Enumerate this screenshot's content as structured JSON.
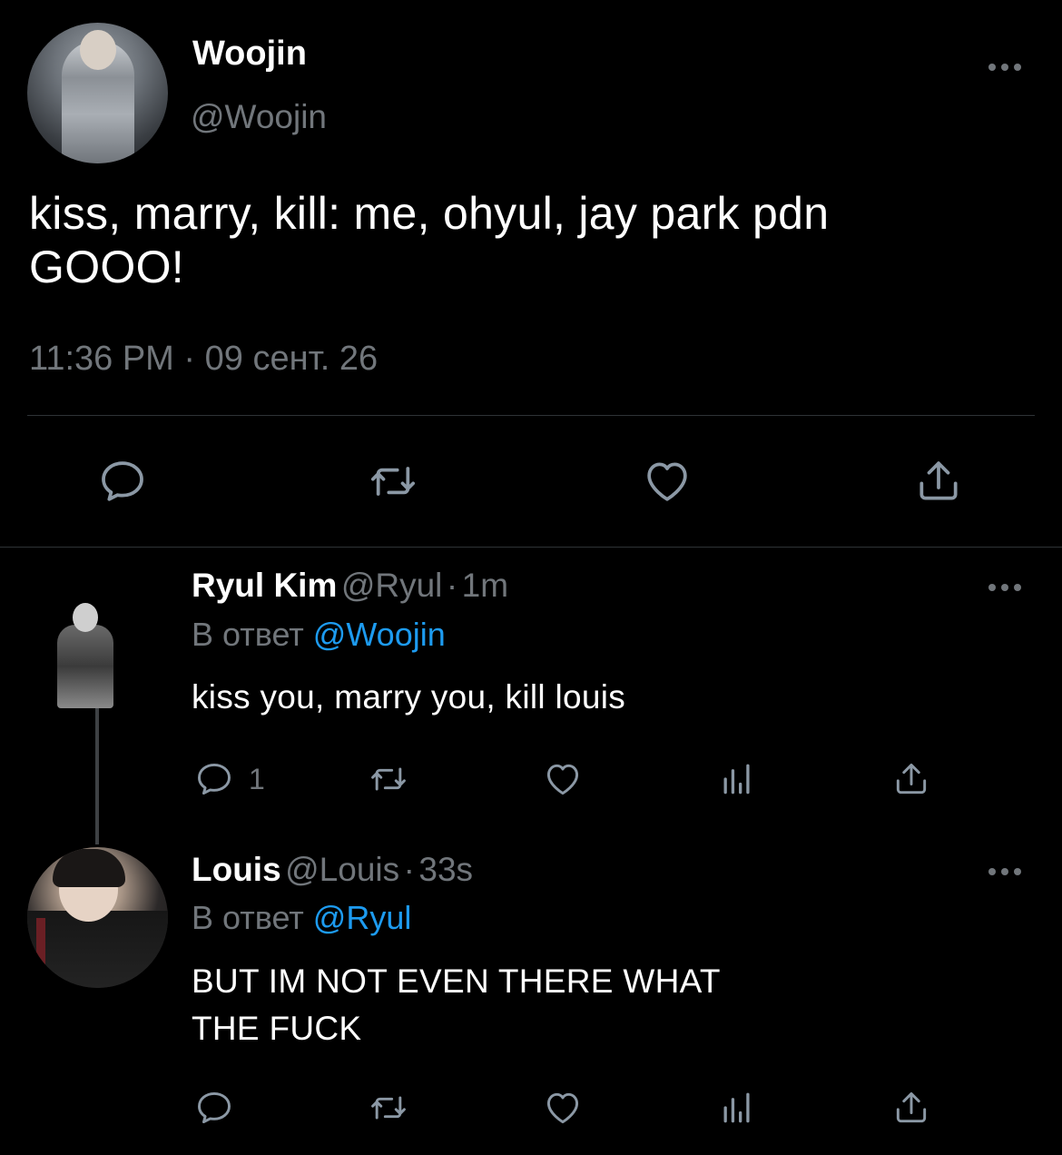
{
  "main_tweet": {
    "author_name": "Woojin",
    "author_handle": "@Woojin",
    "text_line1": "kiss, marry, kill: me, ohyul, jay park pdn",
    "text_line2": "GOOO!",
    "time": "11:36 PM",
    "separator": "·",
    "date": "09 сент. 26",
    "actions": [
      "reply-icon",
      "retweet-icon",
      "like-icon",
      "share-icon"
    ]
  },
  "replies": [
    {
      "author_name": "Ryul Kim",
      "author_handle": "@Ryul",
      "separator": "·",
      "age": "1m",
      "reply_prefix": "В ответ",
      "reply_mention": "@Woojin",
      "text_lines": [
        "kiss you, marry you, kill louis"
      ],
      "reply_count": "1",
      "actions": [
        "reply-icon",
        "retweet-icon",
        "like-icon",
        "analytics-icon",
        "share-icon"
      ]
    },
    {
      "author_name": "Louis",
      "author_handle": "@Louis",
      "separator": "·",
      "age": "33s",
      "reply_prefix": "В ответ",
      "reply_mention": "@Ryul",
      "text_lines": [
        "BUT IM NOT EVEN THERE WHAT",
        "THE FUCK"
      ],
      "reply_count": "",
      "actions": [
        "reply-icon",
        "retweet-icon",
        "like-icon",
        "analytics-icon",
        "share-icon"
      ]
    }
  ],
  "colors": {
    "background": "#000000",
    "primary_text": "#ffffff",
    "secondary_text": "#71767b",
    "mention": "#1d9bf0",
    "icon": "#8b98a5",
    "divider": "#2f3336"
  }
}
